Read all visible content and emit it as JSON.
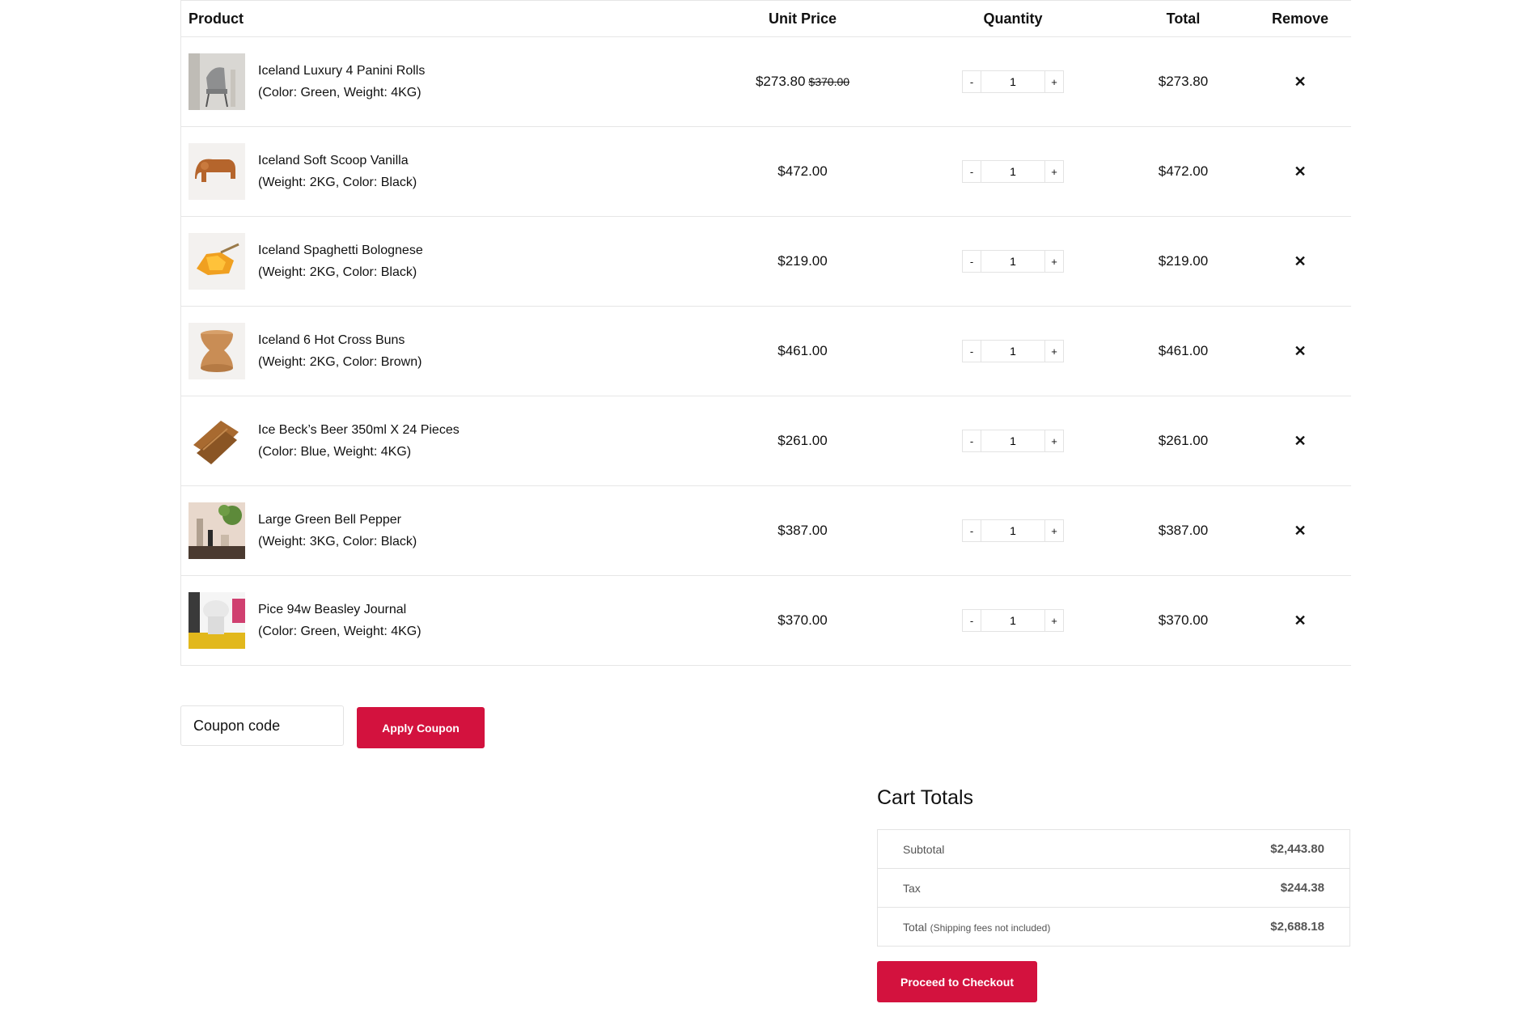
{
  "table": {
    "headers": {
      "product": "Product",
      "unit_price": "Unit Price",
      "quantity": "Quantity",
      "total": "Total",
      "remove": "Remove"
    },
    "rows": [
      {
        "name": "Iceland Luxury 4 Panini Rolls",
        "attrs": "(Color: Green, Weight: 4KG)",
        "price": "$273.80",
        "old_price": "$370.00",
        "qty": "1",
        "total": "$273.80",
        "thumb": "chair-photo"
      },
      {
        "name": "Iceland Soft Scoop Vanilla",
        "attrs": "(Weight: 2KG, Color: Black)",
        "price": "$472.00",
        "old_price": "",
        "qty": "1",
        "total": "$472.00",
        "thumb": "elephant-toy-photo"
      },
      {
        "name": "Iceland Spaghetti Bolognese",
        "attrs": "(Weight: 2KG, Color: Black)",
        "price": "$219.00",
        "old_price": "",
        "qty": "1",
        "total": "$219.00",
        "thumb": "honeycomb-photo"
      },
      {
        "name": "Iceland 6 Hot Cross Buns",
        "attrs": "(Weight: 2KG, Color: Brown)",
        "price": "$461.00",
        "old_price": "",
        "qty": "1",
        "total": "$461.00",
        "thumb": "cork-stool-photo"
      },
      {
        "name": "Ice Beck’s Beer 350ml X 24 Pieces",
        "attrs": "(Color: Blue, Weight: 4KG)",
        "price": "$261.00",
        "old_price": "",
        "qty": "1",
        "total": "$261.00",
        "thumb": "wooden-boards-photo"
      },
      {
        "name": "Large Green Bell Pepper",
        "attrs": "(Weight: 3KG, Color: Black)",
        "price": "$387.00",
        "old_price": "",
        "qty": "1",
        "total": "$387.00",
        "thumb": "plant-shelf-photo"
      },
      {
        "name": "Pice 94w Beasley Journal",
        "attrs": "(Color: Green, Weight: 4KG)",
        "price": "$370.00",
        "old_price": "",
        "qty": "1",
        "total": "$370.00",
        "thumb": "lamp-photo"
      }
    ],
    "minus_label": "-",
    "plus_label": "+",
    "remove_label": "✕"
  },
  "coupon": {
    "placeholder": "Coupon code",
    "apply_label": "Apply Coupon"
  },
  "totals": {
    "title": "Cart Totals",
    "subtotal_label": "Subtotal",
    "subtotal_value": "$2,443.80",
    "tax_label": "Tax",
    "tax_value": "$244.38",
    "total_label": "Total",
    "total_note": "(Shipping fees not included)",
    "total_value": "$2,688.18",
    "checkout_label": "Proceed to Checkout"
  },
  "colors": {
    "accent": "#d3123e",
    "border": "#e6e6e6"
  }
}
